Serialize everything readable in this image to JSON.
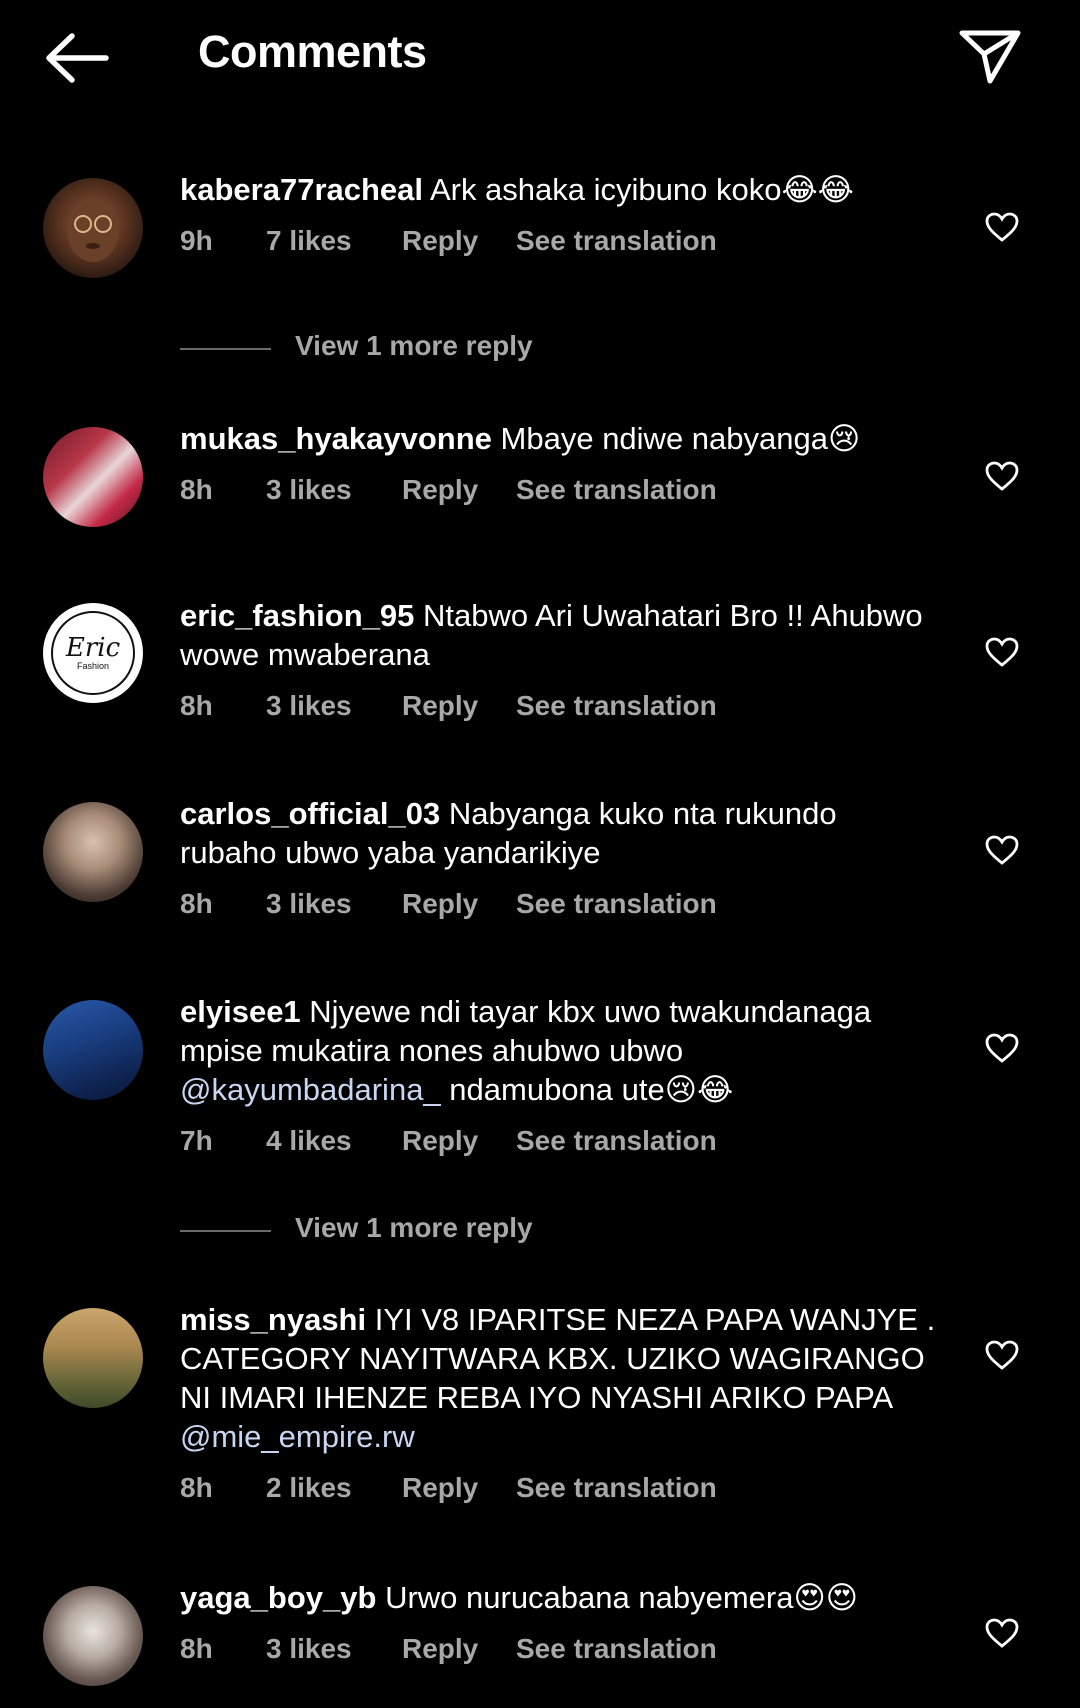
{
  "header": {
    "title": "Comments",
    "back_icon": "arrow-left-icon",
    "share_icon": "paper-plane-icon"
  },
  "comments": [
    {
      "username": "kabera77racheal",
      "text": "Ark ashaka icyibuno koko😂😂",
      "time": "9h",
      "likes": "7 likes",
      "reply": "Reply",
      "translation": "See translation",
      "view_more": "View 1 more reply"
    },
    {
      "username": "mukas_hyakayvonne",
      "text": "Mbaye ndiwe nabyanga😢",
      "time": "8h",
      "likes": "3 likes",
      "reply": "Reply",
      "translation": "See translation"
    },
    {
      "username": "eric_fashion_95",
      "text": "Ntabwo Ari Uwahatari Bro !! Ahubwo wowe mwaberana",
      "time": "8h",
      "likes": "3 likes",
      "reply": "Reply",
      "translation": "See translation",
      "avatar_text": "Eric",
      "avatar_subtext": "Fashion"
    },
    {
      "username": "carlos_official_03",
      "text": "Nabyanga kuko nta rukundo rubaho ubwo yaba yandarikiye",
      "time": "8h",
      "likes": "3 likes",
      "reply": "Reply",
      "translation": "See translation"
    },
    {
      "username": "elyisee1",
      "text": "Njyewe ndi tayar kbx uwo twakundanaga mpise mukatira nones ahubwo ubwo",
      "mention": "@kayumbadarina_",
      "text_after": " ndamubona ute😢😂",
      "time": "7h",
      "likes": "4 likes",
      "reply": "Reply",
      "translation": "See translation",
      "view_more": "View 1 more reply"
    },
    {
      "username": "miss_nyashi",
      "text": "IYI V8 IPARITSE NEZA PAPA WANJYE . CATEGORY NAYITWARA KBX. UZIKO WAGIRANGO NI IMARI IHENZE REBA IYO NYASHI ARIKO PAPA",
      "mention": "@mie_empire.rw",
      "time": "8h",
      "likes": "2 likes",
      "reply": "Reply",
      "translation": "See translation"
    },
    {
      "username": "yaga_boy_yb",
      "text": "Urwo nurucabana nabyemera😍😍",
      "time": "8h",
      "likes": "3 likes",
      "reply": "Reply",
      "translation": "See translation"
    }
  ],
  "colors": {
    "background": "#000000",
    "text": "#ffffff",
    "secondary": "#a8a8a8",
    "mention": "#c8d6f2"
  }
}
